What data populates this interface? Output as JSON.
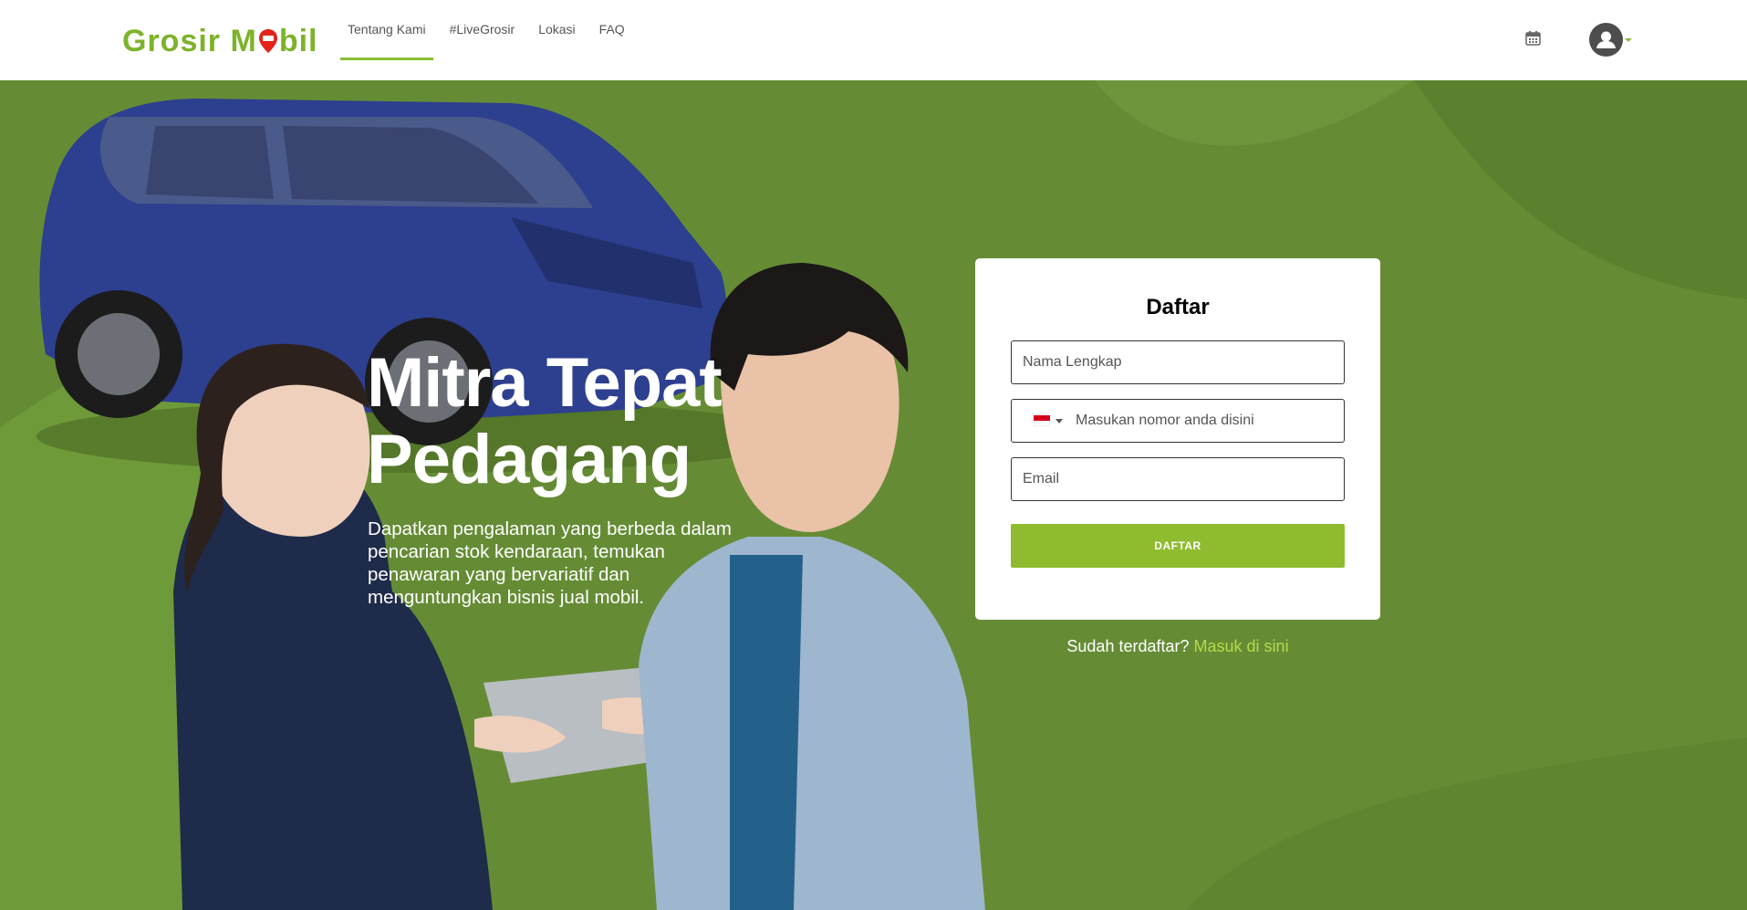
{
  "brand": {
    "logo_left": "Grosir M",
    "logo_right": "bil",
    "accent_color": "#8fbc2f"
  },
  "nav": {
    "items": [
      {
        "label": "Tentang Kami",
        "active": true
      },
      {
        "label": "#LiveGrosir",
        "active": false
      },
      {
        "label": "Lokasi",
        "active": false
      },
      {
        "label": "FAQ",
        "active": false
      }
    ],
    "icons": [
      "calendar-icon",
      "user-avatar-icon"
    ]
  },
  "hero": {
    "title_line1": "Mitra Tepat",
    "title_line2": "Pedagang",
    "description": "Dapatkan pengalaman yang berbeda dalam pencarian stok kendaraan, temukan penawaran yang bervariatif dan menguntungkan bisnis jual mobil."
  },
  "form": {
    "title": "Daftar",
    "name_placeholder": "Nama Lengkap",
    "phone_placeholder": "Masukan nomor anda disini",
    "email_placeholder": "Email",
    "submit_label": "DAFTAR",
    "login_prompt": "Sudah terdaftar?",
    "login_link": "Masuk di sini"
  }
}
